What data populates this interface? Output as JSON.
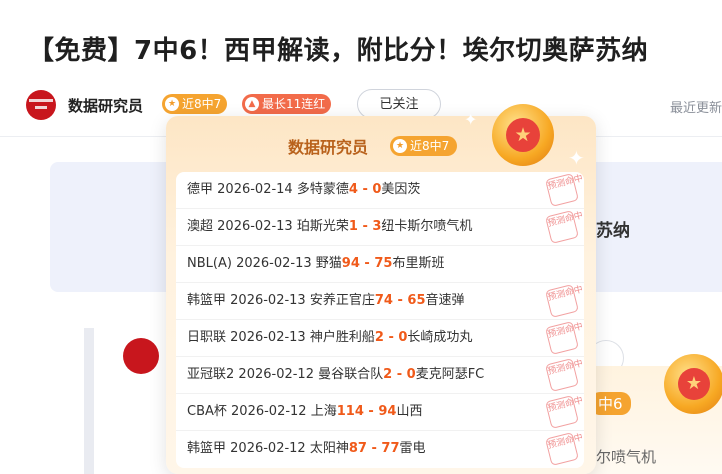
{
  "article": {
    "title": "【免费】7中6！西甲解读，附比分！埃尔切奥萨苏纳"
  },
  "author": {
    "name": "数据研究员",
    "badge_recent": "近8中7",
    "badge_streak": "最长11连红",
    "follow_label": "已关注",
    "update_text": "最近更新"
  },
  "background": {
    "match_text": "苏纳",
    "card2_badge": "中6",
    "card2_text": "尔喷气机"
  },
  "popup": {
    "name": "数据研究员",
    "badge": "近8中7",
    "stamp_text": "预测命中",
    "items": [
      {
        "league": "德甲",
        "date": "2026-02-14",
        "home": "多特蒙德",
        "home_score": "4",
        "sep": " - ",
        "away_score": "0",
        "away": "美因茨",
        "hit": true
      },
      {
        "league": "澳超",
        "date": "2026-02-13",
        "home": "珀斯光荣",
        "home_score": "1",
        "sep": " - ",
        "away_score": "3",
        "away": "纽卡斯尔喷气机",
        "hit": true
      },
      {
        "league": "NBL(A)",
        "date": "2026-02-13",
        "home": "野猫",
        "home_score": "94",
        "sep": " - ",
        "away_score": "75",
        "away": "布里斯班",
        "hit": false
      },
      {
        "league": "韩篮甲",
        "date": "2026-02-13",
        "home": "安养正官庄",
        "home_score": "74",
        "sep": " - ",
        "away_score": "65",
        "away": "音速弹",
        "hit": true
      },
      {
        "league": "日职联",
        "date": "2026-02-13",
        "home": "神户胜利船",
        "home_score": "2",
        "sep": " - ",
        "away_score": "0",
        "away": "长崎成功丸",
        "hit": true
      },
      {
        "league": "亚冠联2",
        "date": "2026-02-12",
        "home": "曼谷联合队",
        "home_score": "2",
        "sep": " - ",
        "away_score": "0",
        "away": "麦克阿瑟FC",
        "hit": true
      },
      {
        "league": "CBA杯",
        "date": "2026-02-12",
        "home": "上海",
        "home_score": "114",
        "sep": " - ",
        "away_score": "94",
        "away": "山西",
        "hit": true
      },
      {
        "league": "韩篮甲",
        "date": "2026-02-12",
        "home": "太阳神",
        "home_score": "87",
        "sep": " - ",
        "away_score": "77",
        "away": "雷电",
        "hit": true
      }
    ]
  },
  "icons": {
    "badge_icon": "star-icon",
    "streak_icon": "flame-icon",
    "medal_icon": "star-medal-icon"
  },
  "colors": {
    "score": "#f05a1a",
    "badge_orange": "#f5a430",
    "badge_red": "#f26b4a",
    "popup_name": "#b9621c"
  }
}
